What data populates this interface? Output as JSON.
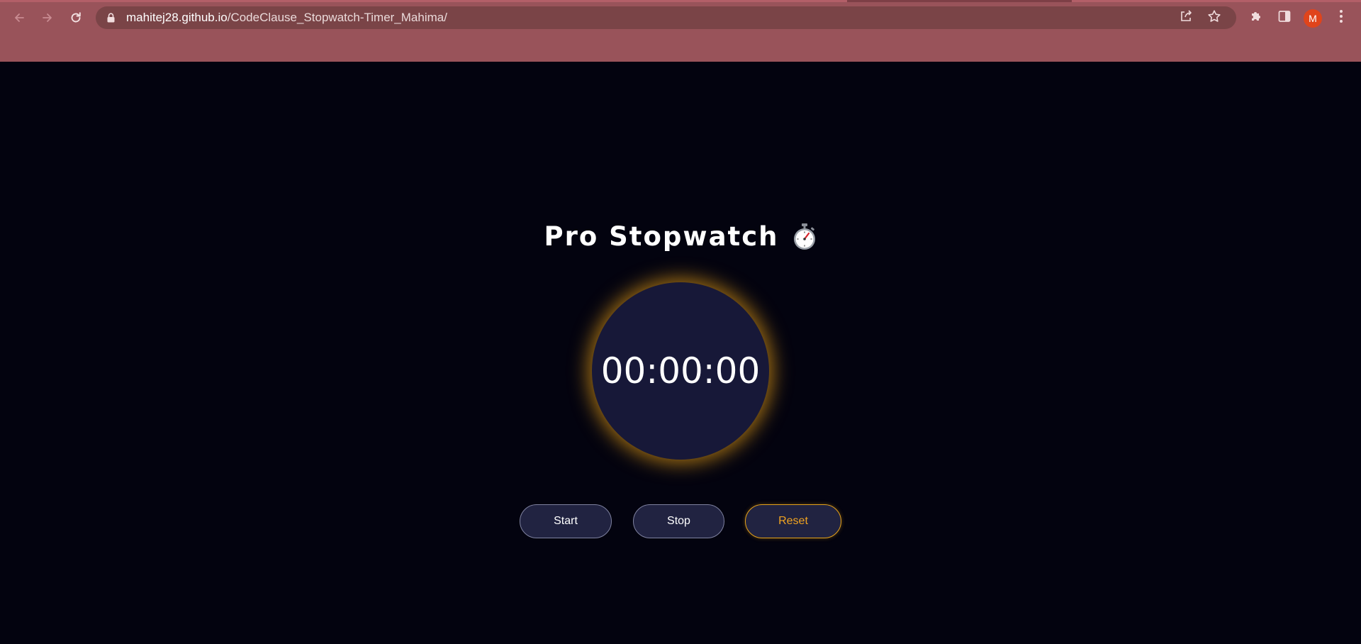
{
  "browser": {
    "url_host": "mahitej28.github.io",
    "url_path": "/CodeClause_Stopwatch-Timer_Mahima/",
    "profile_initial": "M",
    "icons": {
      "back": "arrow-left-icon",
      "forward": "arrow-right-icon",
      "reload": "reload-icon",
      "lock": "lock-icon",
      "share": "share-icon",
      "bookmark": "star-icon",
      "extensions": "puzzle-icon",
      "side_panel": "side-panel-icon",
      "menu": "kebab-menu-icon"
    },
    "colors": {
      "chrome": "#99535a",
      "omnibox": "#7a4447",
      "avatar": "#e0441b"
    }
  },
  "app": {
    "title": "Pro Stopwatch",
    "title_emoji_icon": "stopwatch-icon",
    "time": "00:00:00",
    "buttons": {
      "start": "Start",
      "stop": "Stop",
      "reset": "Reset"
    },
    "colors": {
      "background": "#03030f",
      "dial": "#171838",
      "glow": "#e9a016",
      "button": "#212341",
      "reset_accent": "#f0a321"
    }
  }
}
